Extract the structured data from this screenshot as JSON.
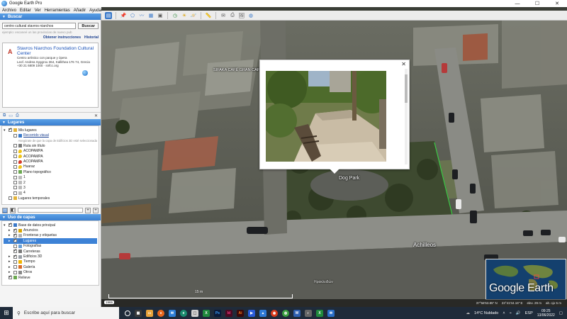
{
  "window": {
    "title": "Google Earth Pro",
    "min": "—",
    "max": "☐",
    "close": "✕"
  },
  "menu": [
    "Archivo",
    "Editar",
    "Ver",
    "Herramientas",
    "Añadir",
    "Ayuda"
  ],
  "search": {
    "header": "Buscar",
    "value": "centro cultural stavros niarchos",
    "button": "Buscar",
    "hint": "ejemplo: escaneé un las provincias de nuevo pub",
    "links": [
      "Obtener instrucciones",
      "Historial"
    ],
    "result": {
      "marker": "A",
      "title": "Stavros Niarchos Foundation Cultural Center",
      "lines": [
        "Centro artístico con parque y ópera",
        "Leof. Andrea Syggrou 364, Kallithea 176 74, Grecia",
        "+30 21 6809 1000 · snfcc.org"
      ]
    }
  },
  "places": {
    "header": "Lugares",
    "items": [
      {
        "label": "Mis lugares",
        "indent": 0,
        "checked": true,
        "expander": "▾",
        "icon": "folder"
      },
      {
        "label": "Recorrido visual",
        "indent": 1,
        "checked": false,
        "icon": "tour",
        "link": true
      },
      {
        "label": "Asegúrate de que la capa de Edificios 3D esté seleccionada",
        "indent": 2,
        "note": true
      },
      {
        "label": "Ruta sin título",
        "indent": 1,
        "checked": false,
        "icon": "path"
      },
      {
        "label": "ACOPAMPA",
        "indent": 1,
        "checked": false,
        "icon": "pin-yellow"
      },
      {
        "label": "ACOPAMPA",
        "indent": 1,
        "checked": false,
        "icon": "pin-yellow"
      },
      {
        "label": "ACOPAMPA",
        "indent": 1,
        "checked": false,
        "icon": "pin-red"
      },
      {
        "label": "Huaraz",
        "indent": 1,
        "checked": false,
        "icon": "pin-yellow"
      },
      {
        "label": "Plano topográfico",
        "indent": 1,
        "checked": false,
        "icon": "image"
      },
      {
        "label": "1",
        "indent": 1,
        "checked": false,
        "icon": "dot"
      },
      {
        "label": "2",
        "indent": 1,
        "checked": false,
        "icon": "dot"
      },
      {
        "label": "3",
        "indent": 1,
        "checked": false,
        "icon": "dot"
      },
      {
        "label": "4",
        "indent": 1,
        "checked": false,
        "icon": "dot"
      },
      {
        "label": "Lugares temporales",
        "indent": 0,
        "checked": false,
        "icon": "folder"
      }
    ]
  },
  "layers": {
    "header": "Uso de capas",
    "items": [
      {
        "label": "Base de datos principal",
        "indent": 0,
        "expander": "▾",
        "checked": true,
        "icon": "globe"
      },
      {
        "label": "Anuncios",
        "indent": 1,
        "expander": "▸",
        "checked": true,
        "icon": "doc"
      },
      {
        "label": "Fronteras y etiquetas",
        "indent": 1,
        "expander": "▸",
        "checked": true,
        "icon": "border"
      },
      {
        "label": "Lugares",
        "indent": 1,
        "expander": "▸",
        "checked": true,
        "icon": "places",
        "selected": true
      },
      {
        "label": "Fotografías",
        "indent": 1,
        "expander": "",
        "checked": false,
        "icon": "photo"
      },
      {
        "label": "Carreteras",
        "indent": 1,
        "expander": "",
        "checked": true,
        "icon": "road"
      },
      {
        "label": "Edificios 3D",
        "indent": 1,
        "expander": "▸",
        "checked": true,
        "icon": "building"
      },
      {
        "label": "Tiempo",
        "indent": 1,
        "expander": "▸",
        "checked": false,
        "icon": "weather"
      },
      {
        "label": "Galería",
        "indent": 1,
        "expander": "▸",
        "checked": false,
        "icon": "gallery"
      },
      {
        "label": "Otros",
        "indent": 1,
        "expander": "▸",
        "checked": false,
        "icon": "other"
      },
      {
        "label": "Relieve",
        "indent": 0,
        "expander": "",
        "checked": true,
        "icon": "terrain"
      }
    ]
  },
  "map": {
    "labels": {
      "dog_park": "Dog Park",
      "street": "Achilleos",
      "place": "SIFAKA CAFÉ GRAN CAFE",
      "street2": "Ηρακλειδών"
    },
    "logo": "Google Earth",
    "year": "1965",
    "scale": "15 m",
    "status": [
      "37°56'53.85\" N",
      "23°41'34.16\" E",
      "elev. 29 m",
      "alt. ojo 5 m"
    ]
  },
  "taskbar": {
    "search_placeholder": "Escribe aquí para buscar",
    "weather": "14°C  Nublado",
    "lang": "ESP",
    "time": "09:25",
    "date": "13/06/2022"
  }
}
